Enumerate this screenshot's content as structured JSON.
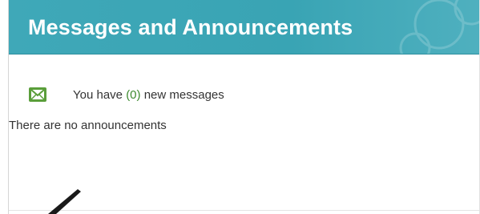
{
  "panel": {
    "title": "Messages and Announcements",
    "header_color": "#3fa8b8",
    "messages": {
      "prefix": "You have ",
      "count": "(0)",
      "suffix": " new messages",
      "icon": "envelope-icon",
      "icon_color": "#5a9e3a"
    },
    "announcements_text": "There are no announcements"
  },
  "annotation": {
    "icon": "pen-stroke-marker",
    "color": "#1a1a1a"
  }
}
